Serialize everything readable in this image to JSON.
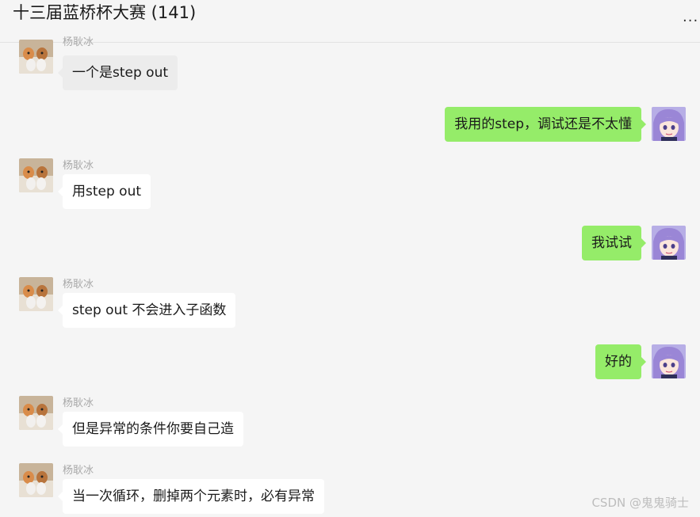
{
  "header": {
    "title": "十三届蓝桥杯大赛 (141)",
    "more_label": "..."
  },
  "messages": [
    {
      "direction": "in",
      "sender": "杨耿冰",
      "text": "一个是step out",
      "highlighted": true
    },
    {
      "direction": "out",
      "sender": "",
      "text": "我用的step，调试还是不太懂"
    },
    {
      "direction": "in",
      "sender": "杨耿冰",
      "text": "用step out"
    },
    {
      "direction": "out",
      "sender": "",
      "text": "我试试"
    },
    {
      "direction": "in",
      "sender": "杨耿冰",
      "text": "step out 不会进入子函数"
    },
    {
      "direction": "out",
      "sender": "",
      "text": "好的"
    },
    {
      "direction": "in",
      "sender": "杨耿冰",
      "text": "但是异常的条件你要自己造"
    },
    {
      "direction": "in",
      "sender": "杨耿冰",
      "text": "当一次循环，删掉两个元素时，必有异常"
    }
  ],
  "watermark": "CSDN @鬼鬼骑士",
  "colors": {
    "background": "#f5f5f5",
    "incoming_bubble": "#ffffff",
    "outgoing_bubble": "#95ec69",
    "sender_name": "#a8a8a8"
  }
}
